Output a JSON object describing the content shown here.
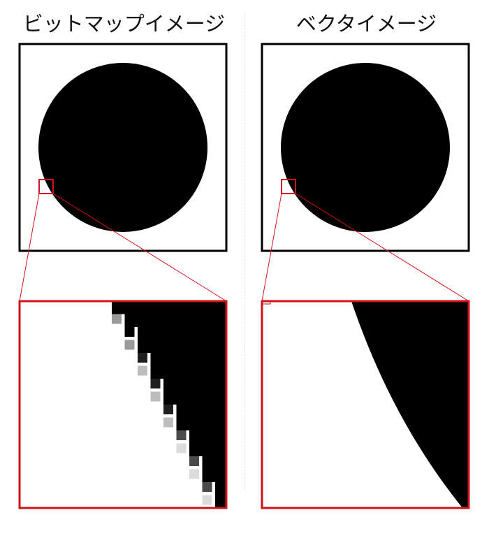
{
  "left_panel": {
    "title": "ビットマップイメージ"
  },
  "right_panel": {
    "title": "ベクタイメージ"
  },
  "colors": {
    "frame": "#000000",
    "shape": "#000000",
    "highlight": "#d0121b",
    "background": "#ffffff"
  }
}
